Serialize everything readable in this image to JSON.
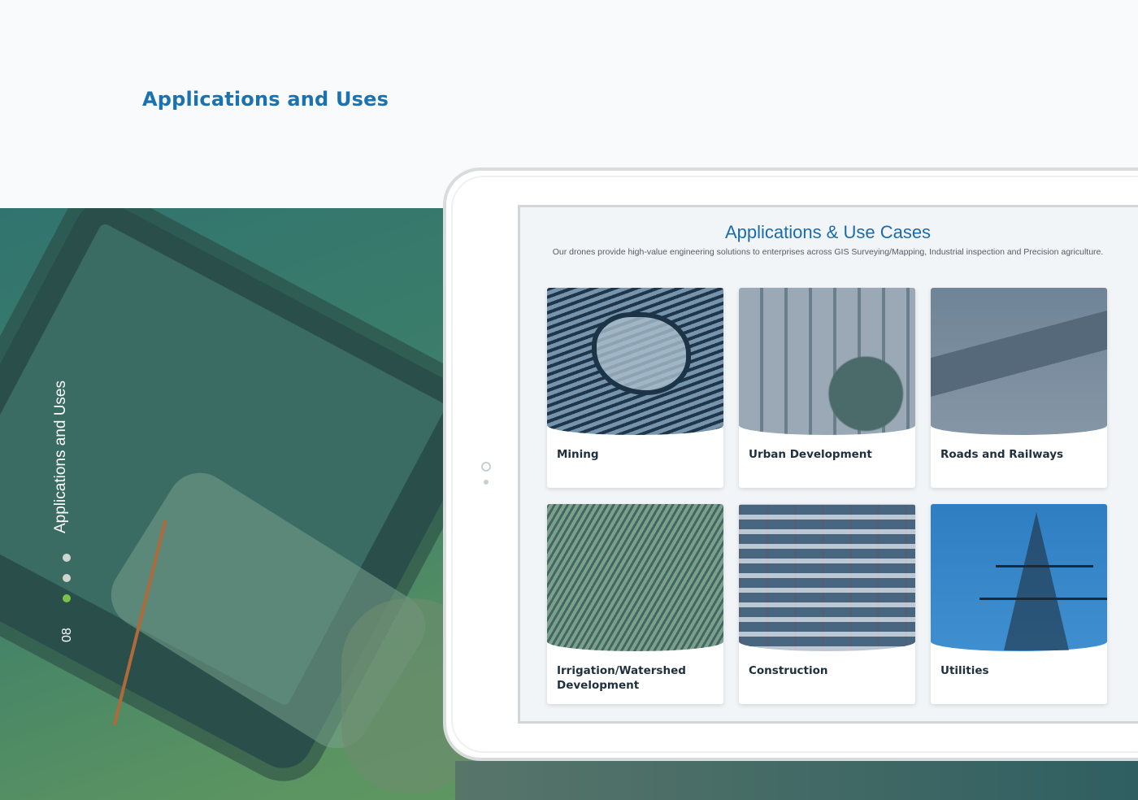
{
  "page_heading": "Applications and Uses",
  "side_nav": {
    "vertical_label": "Applications and Uses",
    "slide_number": "08",
    "dots": [
      {
        "state": "inactive"
      },
      {
        "state": "inactive"
      },
      {
        "state": "active"
      }
    ],
    "active_color": "#7cc24a"
  },
  "screen": {
    "title": "Applications & Use Cases",
    "subtitle": "Our drones provide high-value engineering solutions to enterprises across GIS Surveying/Mapping, Industrial inspection and Precision agriculture.",
    "cards": [
      {
        "label": "Mining",
        "image": "aerial-mine-image"
      },
      {
        "label": "Urban Development",
        "image": "aerial-city-image"
      },
      {
        "label": "Roads and Railways",
        "image": "aerial-road-image"
      },
      {
        "label": "Irrigation/Watershed Development",
        "image": "aerial-farmland-image"
      },
      {
        "label": "Construction",
        "image": "construction-site-image"
      },
      {
        "label": "Utilities",
        "image": "power-pylon-image"
      }
    ]
  },
  "colors": {
    "heading_blue": "#1a72b0",
    "screen_title_blue": "#1a6cab",
    "band_green": "#3d7f69"
  }
}
